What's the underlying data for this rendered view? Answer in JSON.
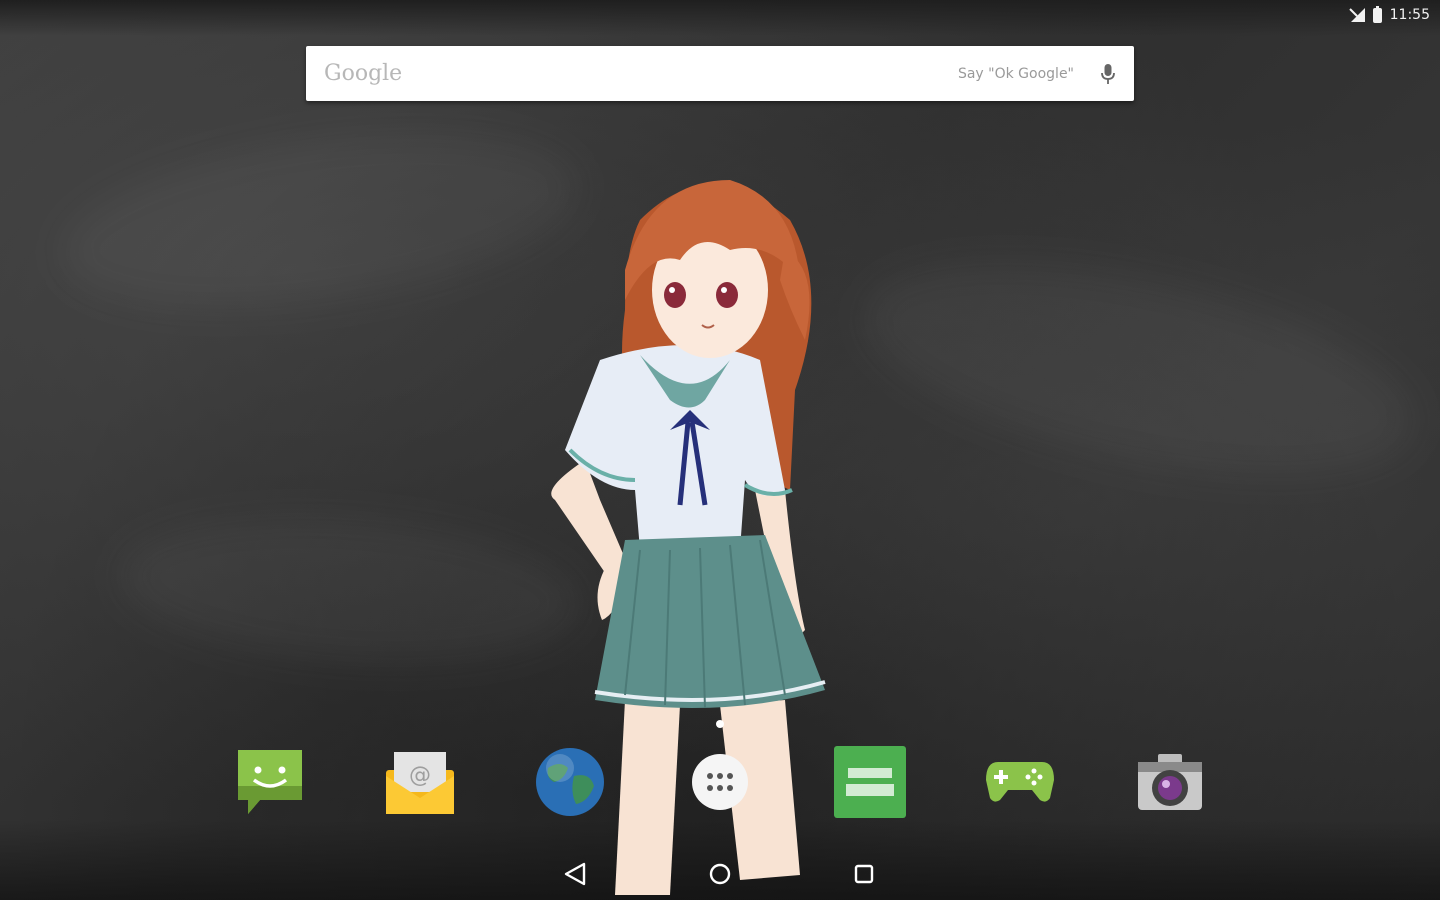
{
  "status_bar": {
    "time": "11:55",
    "icons": [
      "signal-icon",
      "battery-icon"
    ]
  },
  "search_bar": {
    "logo_text": "Google",
    "voice_hint": "Say \"Ok Google\"",
    "icon": "mic-icon"
  },
  "dock": {
    "apps": [
      {
        "icon": "messaging-icon"
      },
      {
        "icon": "email-icon"
      },
      {
        "icon": "browser-icon"
      },
      {
        "icon": "app-drawer-icon"
      },
      {
        "icon": "live-wallpaper-app-icon"
      },
      {
        "icon": "games-icon"
      },
      {
        "icon": "camera-icon"
      }
    ]
  },
  "nav_bar": {
    "buttons": [
      "back-icon",
      "home-icon",
      "recents-icon"
    ]
  },
  "colors": {
    "background": "#333333",
    "messaging": "#8bc34a",
    "email": "#f5b81c",
    "browser": "#2a6fb5",
    "games": "#8bc34a",
    "live_wallpaper": "#4caf50"
  }
}
